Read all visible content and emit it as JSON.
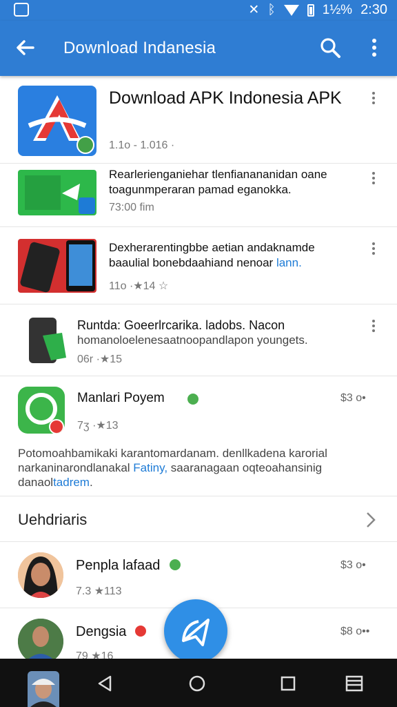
{
  "status_bar": {
    "battery": "1½%",
    "time": "2:30"
  },
  "app_bar": {
    "title": "Download Indanesia"
  },
  "apps": [
    {
      "title": "Download APK Indonesia APK",
      "meta": "1.1o - 1.016 ·"
    },
    {
      "title": "Rearlerienganiehar tlenfianananidan oane toagunmperaran pamad eganokka.",
      "meta": "73:00 fim"
    },
    {
      "title": "Dexherarentingbbe aetian andaknamde baaulial bonebdaahiand nenoar",
      "title_link": "lann.",
      "meta": "11o ·★14 ☆"
    },
    {
      "title": "Runtda: Goeerlrcarika. ladobs. Nacon",
      "subtitle": "homanoloelenesaatnoopandlapon youngets.",
      "meta": "06r ·★15"
    },
    {
      "title": "Manlari Poyem",
      "meta": "7ʒ ·★13",
      "price": "$3 o•",
      "description_start": "Potomoahbamikaki karantomardanam. denllkadena karorial narkaninarondlanakal",
      "description_link": "Fatiny,",
      "description_mid": "saaranagaan oqteoahansinig danaol",
      "description_link2": "tadrem",
      "description_end": "."
    }
  ],
  "section": {
    "title": "Uehdriaris"
  },
  "people": [
    {
      "name": "Penpla lafaad",
      "meta": "7.3 ★113",
      "price": "$3 o•"
    },
    {
      "name": "Dengsia",
      "meta": "79 ★16",
      "price": "$8 o••"
    }
  ],
  "colors": {
    "primary": "#2f7dd3",
    "fab": "#2f8fe6",
    "star": "#f4a300",
    "badge_green": "#4caf50",
    "badge_red": "#e53935"
  }
}
